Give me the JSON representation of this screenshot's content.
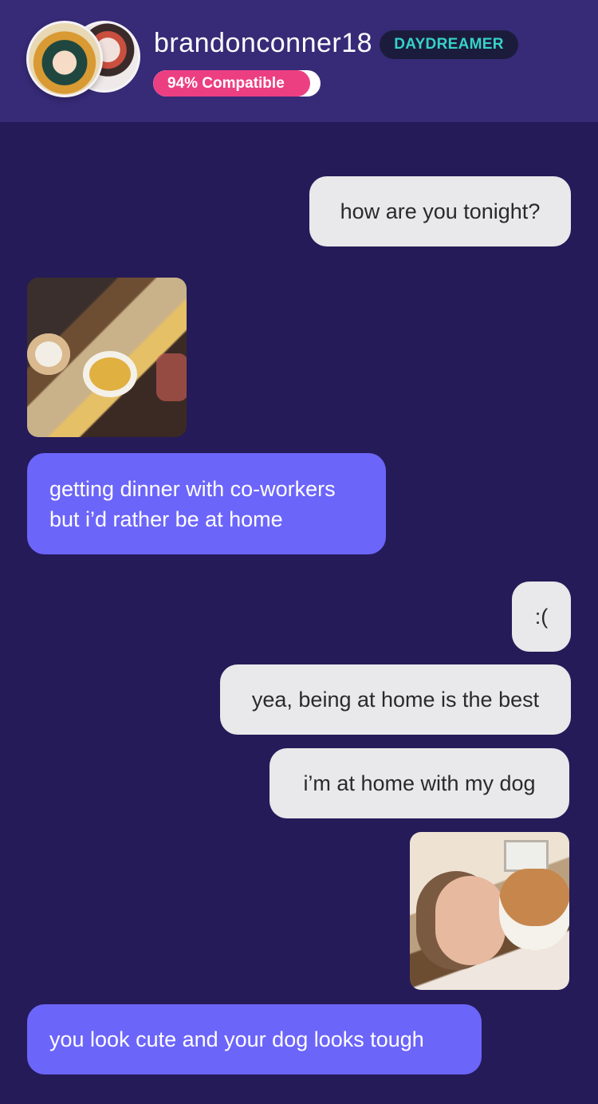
{
  "header": {
    "username": "brandonconner18",
    "badge": "DAYDREAMER",
    "compatibility_label": "94% Compatible",
    "compatibility_percent": 94,
    "avatars": [
      "avatar-user",
      "avatar-match"
    ]
  },
  "messages": [
    {
      "side": "sent",
      "text": "how are you tonight?"
    },
    {
      "side": "received",
      "type": "photo",
      "icon": "food-photo"
    },
    {
      "side": "received",
      "text": "getting dinner with co-workers but i’d rather be at home"
    },
    {
      "side": "sent",
      "text": ":("
    },
    {
      "side": "sent",
      "text": "yea, being at home is the best"
    },
    {
      "side": "sent",
      "text": "i’m at home with my dog"
    },
    {
      "side": "sent",
      "type": "photo",
      "icon": "dog-photo"
    },
    {
      "side": "received",
      "text": "you look cute and your dog looks tough"
    }
  ],
  "colors": {
    "background": "#251b59",
    "header": "#372a77",
    "received_bubble": "#6c65fa",
    "sent_bubble": "#e9e8ea",
    "badge_text": "#36d2c8",
    "compat_accent": "#ec3f82"
  }
}
